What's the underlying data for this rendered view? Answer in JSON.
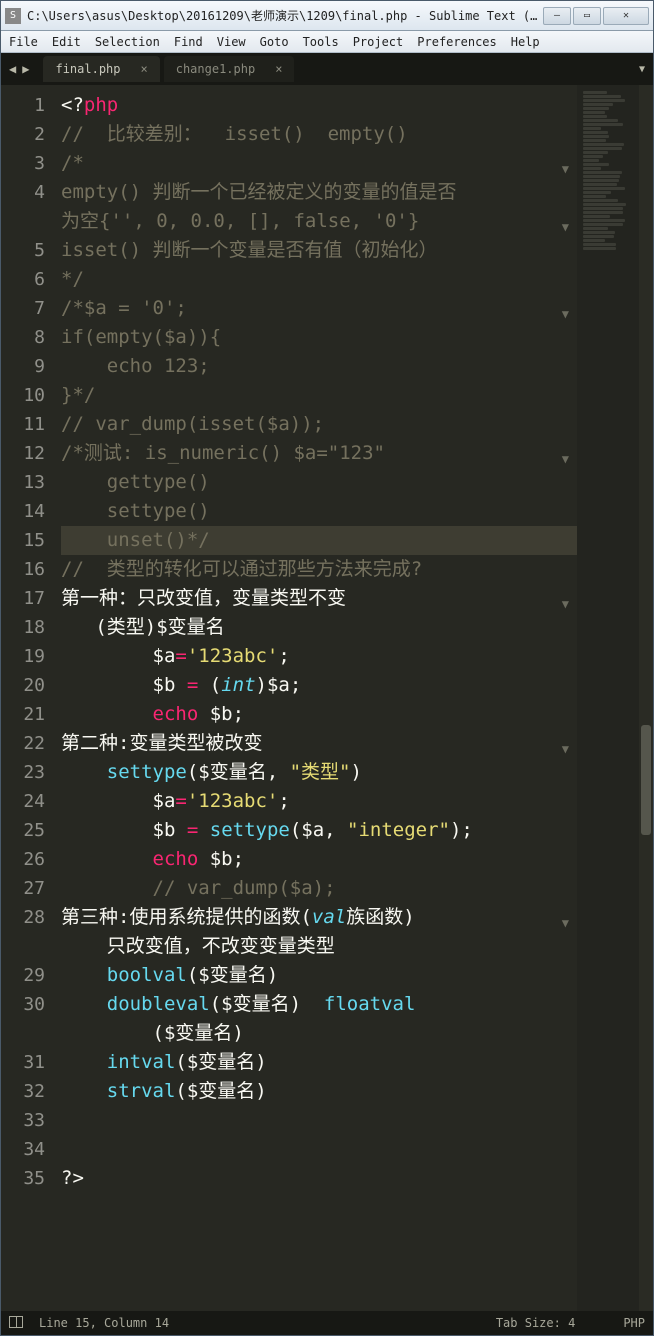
{
  "titlebar": {
    "path": "C:\\Users\\asus\\Desktop\\20161209\\老师演示\\1209\\final.php - Sublime Text (UNREGISTER..."
  },
  "menubar": [
    "File",
    "Edit",
    "Selection",
    "Find",
    "View",
    "Goto",
    "Tools",
    "Project",
    "Preferences",
    "Help"
  ],
  "tabs": [
    {
      "label": "final.php",
      "active": true
    },
    {
      "label": "change1.php",
      "active": false
    }
  ],
  "statusbar": {
    "left": "Line 15, Column 14",
    "tab": "Tab Size: 4",
    "lang": "PHP"
  },
  "code_lines": [
    {
      "n": 1,
      "fold": false,
      "tokens": [
        [
          "c-open",
          "<?"
        ],
        [
          "c-keyword",
          "php"
        ]
      ]
    },
    {
      "n": 2,
      "fold": false,
      "tokens": [
        [
          "c-comment",
          "//  比较差别：  isset()  empty()"
        ]
      ]
    },
    {
      "n": 3,
      "fold": true,
      "tokens": [
        [
          "c-comment",
          "/*"
        ]
      ]
    },
    {
      "n": 4,
      "fold": false,
      "tokens": [
        [
          "c-comment",
          "empty() 判断一个已经被定义的变量的值是否"
        ]
      ]
    },
    {
      "n": "",
      "fold": true,
      "wrap": true,
      "tokens": [
        [
          "c-comment",
          "为空{'', 0, 0.0, [], false, '0'}"
        ]
      ]
    },
    {
      "n": 5,
      "fold": false,
      "tokens": [
        [
          "c-comment",
          "isset() 判断一个变量是否有值（初始化）"
        ]
      ]
    },
    {
      "n": 6,
      "fold": false,
      "tokens": [
        [
          "c-comment",
          "*/"
        ]
      ]
    },
    {
      "n": 7,
      "fold": true,
      "tokens": [
        [
          "c-comment",
          "/*$a = '0';"
        ]
      ]
    },
    {
      "n": 8,
      "fold": false,
      "tokens": [
        [
          "c-comment",
          "if(empty($a)){"
        ]
      ]
    },
    {
      "n": 9,
      "fold": false,
      "tokens": [
        [
          "c-comment",
          "    echo 123;"
        ]
      ]
    },
    {
      "n": 10,
      "fold": false,
      "tokens": [
        [
          "c-comment",
          "}*/"
        ]
      ]
    },
    {
      "n": 11,
      "fold": false,
      "tokens": [
        [
          "c-comment",
          "// var_dump(isset($a));"
        ]
      ]
    },
    {
      "n": 12,
      "fold": true,
      "tokens": [
        [
          "c-comment",
          "/*测试: is_numeric() $a=\"123\""
        ]
      ]
    },
    {
      "n": 13,
      "fold": false,
      "tokens": [
        [
          "c-comment",
          "    gettype()"
        ]
      ]
    },
    {
      "n": 14,
      "fold": false,
      "tokens": [
        [
          "c-comment",
          "    settype()"
        ]
      ]
    },
    {
      "n": 15,
      "fold": false,
      "highlight": true,
      "tokens": [
        [
          "c-comment",
          "    unset()*/"
        ]
      ]
    },
    {
      "n": 16,
      "fold": false,
      "tokens": [
        [
          "c-comment",
          "//  类型的转化可以通过那些方法来完成?"
        ]
      ]
    },
    {
      "n": 17,
      "fold": true,
      "tokens": [
        [
          "c-var",
          "第一种：只改变值，变量类型不变"
        ]
      ]
    },
    {
      "n": 18,
      "fold": false,
      "tokens": [
        [
          "c-var",
          "   (类型)$变量名"
        ]
      ]
    },
    {
      "n": 19,
      "fold": false,
      "tokens": [
        [
          "c-var",
          "        $a"
        ],
        [
          "c-op",
          "="
        ],
        [
          "c-string",
          "'123abc'"
        ],
        [
          "c-var",
          ";"
        ]
      ]
    },
    {
      "n": 20,
      "fold": false,
      "tokens": [
        [
          "c-var",
          "        $b "
        ],
        [
          "c-op",
          "="
        ],
        [
          "c-var",
          " ("
        ],
        [
          "c-type",
          "int"
        ],
        [
          "c-var",
          ")$a;"
        ]
      ]
    },
    {
      "n": 21,
      "fold": false,
      "tokens": [
        [
          "c-var",
          "        "
        ],
        [
          "c-keyword",
          "echo"
        ],
        [
          "c-var",
          " $b;"
        ]
      ]
    },
    {
      "n": 22,
      "fold": true,
      "tokens": [
        [
          "c-var",
          "第二种:变量类型被改变"
        ]
      ]
    },
    {
      "n": 23,
      "fold": false,
      "tokens": [
        [
          "c-var",
          "    "
        ],
        [
          "c-func",
          "settype"
        ],
        [
          "c-var",
          "($变量名, "
        ],
        [
          "c-string",
          "\"类型\""
        ],
        [
          "c-var",
          ")"
        ]
      ]
    },
    {
      "n": 24,
      "fold": false,
      "tokens": [
        [
          "c-var",
          "        $a"
        ],
        [
          "c-op",
          "="
        ],
        [
          "c-string",
          "'123abc'"
        ],
        [
          "c-var",
          ";"
        ]
      ]
    },
    {
      "n": 25,
      "fold": false,
      "tokens": [
        [
          "c-var",
          "        $b "
        ],
        [
          "c-op",
          "="
        ],
        [
          "c-var",
          " "
        ],
        [
          "c-func",
          "settype"
        ],
        [
          "c-var",
          "($a, "
        ],
        [
          "c-string",
          "\"integer\""
        ],
        [
          "c-var",
          ");"
        ]
      ]
    },
    {
      "n": 26,
      "fold": false,
      "tokens": [
        [
          "c-var",
          "        "
        ],
        [
          "c-keyword",
          "echo"
        ],
        [
          "c-var",
          " $b;"
        ]
      ]
    },
    {
      "n": 27,
      "fold": false,
      "tokens": [
        [
          "c-var",
          "        "
        ],
        [
          "c-comment",
          "// var_dump($a);"
        ]
      ]
    },
    {
      "n": 28,
      "fold": true,
      "tokens": [
        [
          "c-var",
          "第三种:使用系统提供的函数("
        ],
        [
          "c-type",
          "val"
        ],
        [
          "c-var",
          "族函数)"
        ]
      ]
    },
    {
      "n": "",
      "fold": false,
      "wrap": true,
      "tokens": [
        [
          "c-var",
          "    只改变值，不改变变量类型"
        ]
      ]
    },
    {
      "n": 29,
      "fold": false,
      "tokens": [
        [
          "c-var",
          "    "
        ],
        [
          "c-func",
          "boolval"
        ],
        [
          "c-var",
          "($变量名)"
        ]
      ]
    },
    {
      "n": 30,
      "fold": false,
      "tokens": [
        [
          "c-var",
          "    "
        ],
        [
          "c-func",
          "doubleval"
        ],
        [
          "c-var",
          "($变量名)  "
        ],
        [
          "c-func",
          "floatval"
        ]
      ]
    },
    {
      "n": "",
      "fold": false,
      "wrap": true,
      "tokens": [
        [
          "c-var",
          "        ($变量名)"
        ]
      ]
    },
    {
      "n": 31,
      "fold": false,
      "tokens": [
        [
          "c-var",
          "    "
        ],
        [
          "c-func",
          "intval"
        ],
        [
          "c-var",
          "($变量名)"
        ]
      ]
    },
    {
      "n": 32,
      "fold": false,
      "tokens": [
        [
          "c-var",
          "    "
        ],
        [
          "c-func",
          "strval"
        ],
        [
          "c-var",
          "($变量名)"
        ]
      ]
    },
    {
      "n": 33,
      "fold": false,
      "tokens": [
        [
          "c-var",
          ""
        ]
      ]
    },
    {
      "n": 34,
      "fold": false,
      "tokens": [
        [
          "c-var",
          ""
        ]
      ]
    },
    {
      "n": 35,
      "fold": false,
      "tokens": [
        [
          "c-open",
          "?>"
        ]
      ]
    }
  ]
}
